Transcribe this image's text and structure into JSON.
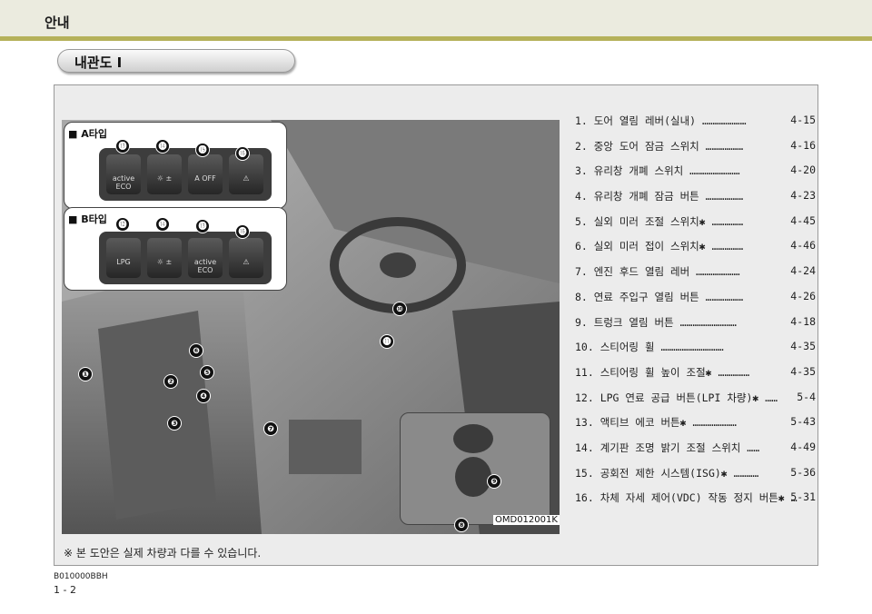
{
  "header": {
    "title": "안내"
  },
  "section": {
    "title": "내관도 I"
  },
  "inset_a": {
    "label": "■ A타입",
    "buttons": [
      "",
      "",
      "A OFF",
      ""
    ],
    "button_text": [
      "active ECO"
    ]
  },
  "inset_b": {
    "label": "■ B타입",
    "buttons": [
      "LPG",
      "",
      "active ECO",
      ""
    ]
  },
  "callouts": {
    "a": [
      "⓭",
      "⓮",
      "⓯",
      "⓰"
    ],
    "b": [
      "⓬",
      "⓮",
      "⓭",
      "⓰"
    ],
    "main": [
      "❶",
      "❷",
      "❸",
      "❹",
      "❺",
      "❻",
      "❼",
      "❽",
      "❾",
      "❿",
      "⓫"
    ]
  },
  "photo": {
    "code": "OMD012001K",
    "note": "※ 본 도안은 실제 차량과 다를 수 있습니다."
  },
  "items": [
    {
      "text": "1. 도어 열림 레버(실내) …………………",
      "page": "4-15"
    },
    {
      "text": "2. 중앙 도어 잠금 스위치 ………………",
      "page": "4-16"
    },
    {
      "text": "3. 유리창 개폐 스위치 ……………………",
      "page": "4-20"
    },
    {
      "text": "4. 유리창 개폐 잠금 버튼 ………………",
      "page": "4-23"
    },
    {
      "text": "5. 실외 미러 조절 스위치✱ ……………",
      "page": "4-45"
    },
    {
      "text": "6. 실외 미러 접이 스위치✱ ……………",
      "page": "4-46"
    },
    {
      "text": "7. 엔진 후드 열림 레버 …………………",
      "page": "4-24"
    },
    {
      "text": "8. 연료 주입구 열림 버튼 ………………",
      "page": "4-26"
    },
    {
      "text": "9. 트렁크 열림 버튼 ………………………",
      "page": "4-18"
    },
    {
      "text": "10. 스티어링 휠 …………………………",
      "page": "4-35"
    },
    {
      "text": "11. 스티어링 휠 높이 조절✱ ……………",
      "page": "4-35"
    },
    {
      "text": "12. LPG 연료 공급 버튼(LPI 차량)✱ ……",
      "page": "5-4"
    },
    {
      "text": "13. 액티브 에코 버튼✱ …………………",
      "page": "5-43"
    },
    {
      "text": "14. 계기판 조명 밝기 조절 스위치 ……",
      "page": "4-49"
    },
    {
      "text": "15. 공회전 제한 시스템(ISG)✱ …………",
      "page": "5-36"
    },
    {
      "text": "16. 차체 자세 제어(VDC) 작동 정지 버튼✱ …",
      "page": "5-31"
    }
  ],
  "footer": {
    "code": "B010000BBH",
    "page": "1 - 2"
  }
}
